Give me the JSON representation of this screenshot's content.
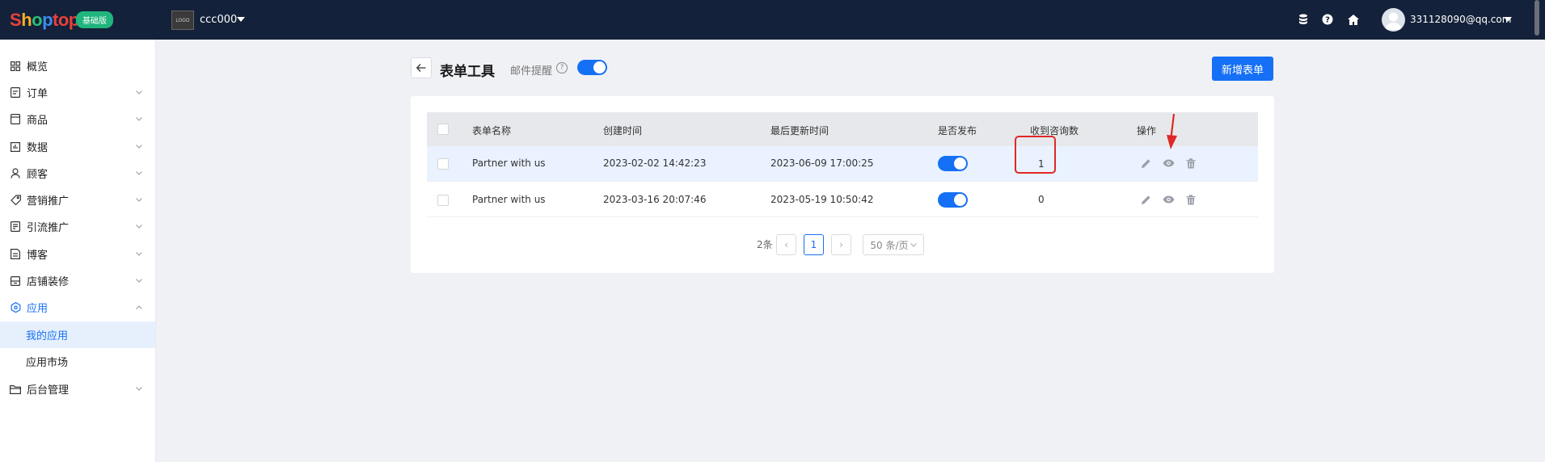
{
  "topbar": {
    "logo": {
      "s": "S",
      "h": "h",
      "o": "o",
      "p": "p",
      "rest": "top"
    },
    "edition_badge": "基础版",
    "store_logo_text": "LOGO",
    "store_name": "ccc000",
    "user_email": "331128090@qq.com",
    "icons": [
      "database-icon",
      "help-icon",
      "home-icon"
    ]
  },
  "sidebar": {
    "items": [
      {
        "label": "概览",
        "icon": "dashboard-icon"
      },
      {
        "label": "订单",
        "icon": "order-icon"
      },
      {
        "label": "商品",
        "icon": "product-icon"
      },
      {
        "label": "数据",
        "icon": "data-icon"
      },
      {
        "label": "顾客",
        "icon": "customer-icon"
      },
      {
        "label": "营销推广",
        "icon": "tag-icon"
      },
      {
        "label": "引流推广",
        "icon": "traffic-icon"
      },
      {
        "label": "博客",
        "icon": "blog-icon"
      },
      {
        "label": "店铺装修",
        "icon": "store-design-icon"
      },
      {
        "label": "应用",
        "icon": "app-icon"
      },
      {
        "label": "后台管理",
        "icon": "folder-icon"
      }
    ],
    "sub_items": [
      {
        "label": "我的应用",
        "selected": true
      },
      {
        "label": "应用市场",
        "selected": false
      }
    ]
  },
  "header": {
    "title": "表单工具",
    "email_reminder_label": "邮件提醒",
    "email_reminder_on": true,
    "new_form_button": "新增表单"
  },
  "table": {
    "columns": [
      "表单名称",
      "创建时间",
      "最后更新时间",
      "是否发布",
      "收到咨询数",
      "操作"
    ],
    "rows": [
      {
        "name": "Partner with us",
        "created": "2023-02-02 14:42:23",
        "updated": "2023-06-09 17:00:25",
        "published": true,
        "inquiries": "1"
      },
      {
        "name": "Partner with us",
        "created": "2023-03-16 20:07:46",
        "updated": "2023-05-19 10:50:42",
        "published": true,
        "inquiries": "0"
      }
    ]
  },
  "pagination": {
    "total": "2条",
    "prev": "‹",
    "current_page": "1",
    "next": "›",
    "page_size": "50 条/页"
  },
  "colors": {
    "accent": "#1670f5",
    "topbar": "#14213a",
    "annotation": "#e02828"
  }
}
